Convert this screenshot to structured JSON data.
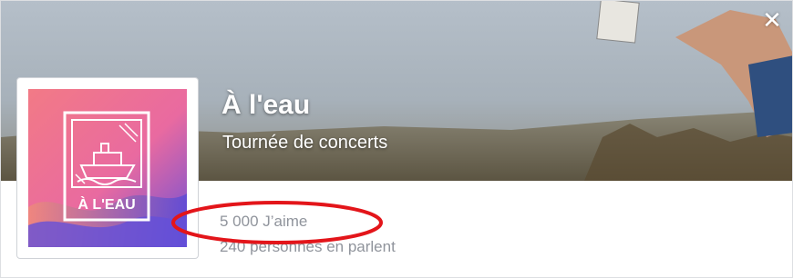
{
  "page": {
    "title": "À l'eau",
    "category": "Tournée de concerts",
    "likes": "5 000 J’aime",
    "talking_about": "240 personnes en parlent",
    "close_icon": "close-icon",
    "close_glyph": "✕"
  },
  "logo": {
    "text": "À L'EAU"
  },
  "colors": {
    "highlight": "#e3151a",
    "muted_text": "#90949c"
  }
}
